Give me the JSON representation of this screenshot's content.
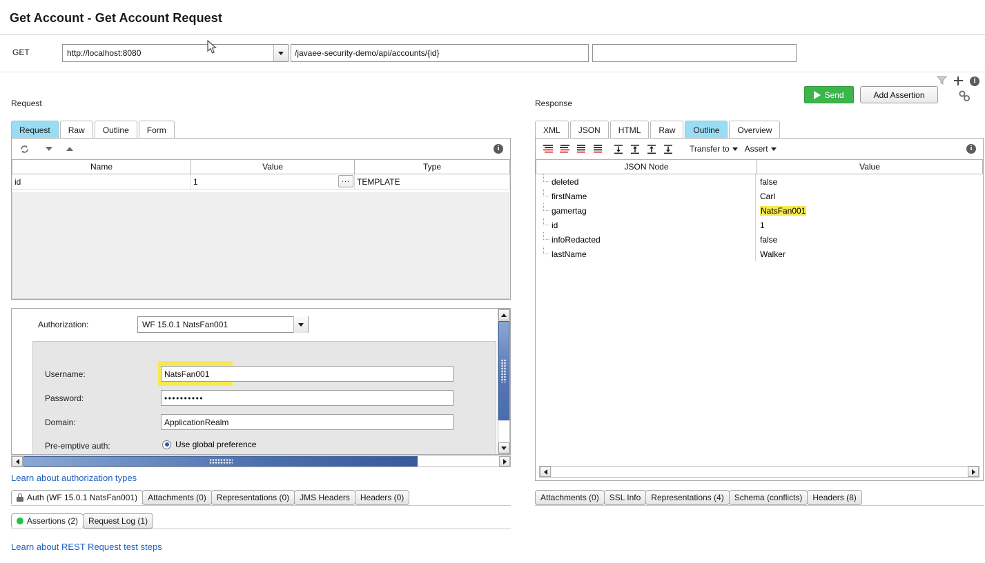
{
  "window": {
    "title": "Get Account - Get Account Request"
  },
  "request_bar": {
    "method": "GET",
    "endpoint": "http://localhost:8080",
    "resource_path": "/javaee-security-demo/api/accounts/{id}",
    "query_string": "",
    "send_label": "Send",
    "add_assertion_label": "Add Assertion",
    "chain_icon": "chain-link-icon",
    "filter_icon": "filter-funnel-icon",
    "plus_icon": "plus-icon",
    "info_icon": "info-icon"
  },
  "request_panel": {
    "caption": "Request",
    "tabs": [
      {
        "label": "Request",
        "active": true
      },
      {
        "label": "Raw",
        "active": false
      },
      {
        "label": "Outline",
        "active": false
      },
      {
        "label": "Form",
        "active": false
      }
    ],
    "toolbar_icons": [
      "recycle-icon",
      "chevron-down-icon",
      "chevron-up-icon",
      "info-icon"
    ],
    "params_table": {
      "columns": [
        "Name",
        "Value",
        "Type"
      ],
      "rows": [
        {
          "name": "id",
          "value": "1",
          "type": "TEMPLATE",
          "editor_button": "..."
        }
      ]
    },
    "auth_form": {
      "authorization_label": "Authorization:",
      "authorization_value": "WF 15.0.1 NatsFan001",
      "fields": [
        {
          "label": "Username:",
          "value": "NatsFan001",
          "highlighted": true
        },
        {
          "label": "Password:",
          "value": "••••••••••",
          "highlighted": false
        },
        {
          "label": "Domain:",
          "value": "ApplicationRealm",
          "highlighted": false
        }
      ],
      "preemptive_label": "Pre-emptive auth:",
      "preemptive_option": "Use global preference"
    },
    "learn_link": "Learn about authorization types",
    "bottom_tabs_row1": [
      {
        "label": "Auth (WF 15.0.1 NatsFan001)",
        "icon": "lock-icon",
        "active": true
      },
      {
        "label": "Attachments (0)",
        "icon": "",
        "active": false
      },
      {
        "label": "Representations (0)",
        "icon": "",
        "active": false
      },
      {
        "label": "JMS Headers",
        "icon": "",
        "active": false
      },
      {
        "label": "Headers (0)",
        "icon": "",
        "active": false
      }
    ],
    "bottom_tabs_row2": [
      {
        "label": "Assertions (2)",
        "icon": "green-status-dot",
        "active": true
      },
      {
        "label": "Request Log (1)",
        "icon": "",
        "active": false
      }
    ]
  },
  "response_panel": {
    "caption": "Response",
    "tabs": [
      {
        "label": "XML",
        "active": false
      },
      {
        "label": "JSON",
        "active": false
      },
      {
        "label": "HTML",
        "active": false
      },
      {
        "label": "Raw",
        "active": false
      },
      {
        "label": "Outline",
        "active": true
      },
      {
        "label": "Overview",
        "active": false
      }
    ],
    "toolbar": {
      "outline_icons": [
        "collapse-all-icon",
        "expand-partial-icon",
        "expand-all-icon",
        "collapse-partial-icon",
        "move-down-icon",
        "move-up-icon",
        "move-top-icon",
        "move-bottom-icon"
      ],
      "transfer_to_label": "Transfer to",
      "assert_label": "Assert",
      "info_icon": "info-icon"
    },
    "outline_table": {
      "columns": [
        "JSON Node",
        "Value"
      ],
      "rows": [
        {
          "node": "deleted",
          "value": "false",
          "highlighted": false
        },
        {
          "node": "firstName",
          "value": "Carl",
          "highlighted": false
        },
        {
          "node": "gamertag",
          "value": "NatsFan001",
          "highlighted": true
        },
        {
          "node": "id",
          "value": "1",
          "highlighted": false
        },
        {
          "node": "infoRedacted",
          "value": "false",
          "highlighted": false
        },
        {
          "node": "lastName",
          "value": "Walker",
          "highlighted": false
        }
      ]
    },
    "bottom_tabs": [
      {
        "label": "Attachments (0)",
        "active": false
      },
      {
        "label": "SSL Info",
        "active": false
      },
      {
        "label": "Representations (4)",
        "active": false
      },
      {
        "label": "Schema (conflicts)",
        "active": false
      },
      {
        "label": "Headers (8)",
        "active": false
      }
    ]
  },
  "footer": {
    "learn_link": "Learn about REST Request test steps"
  },
  "colors": {
    "active_tab": "#9adcf4",
    "send_button": "#3cb54a",
    "highlight": "#f5ea4e",
    "link": "#1f5fbf",
    "status_ok": "#23c246"
  }
}
